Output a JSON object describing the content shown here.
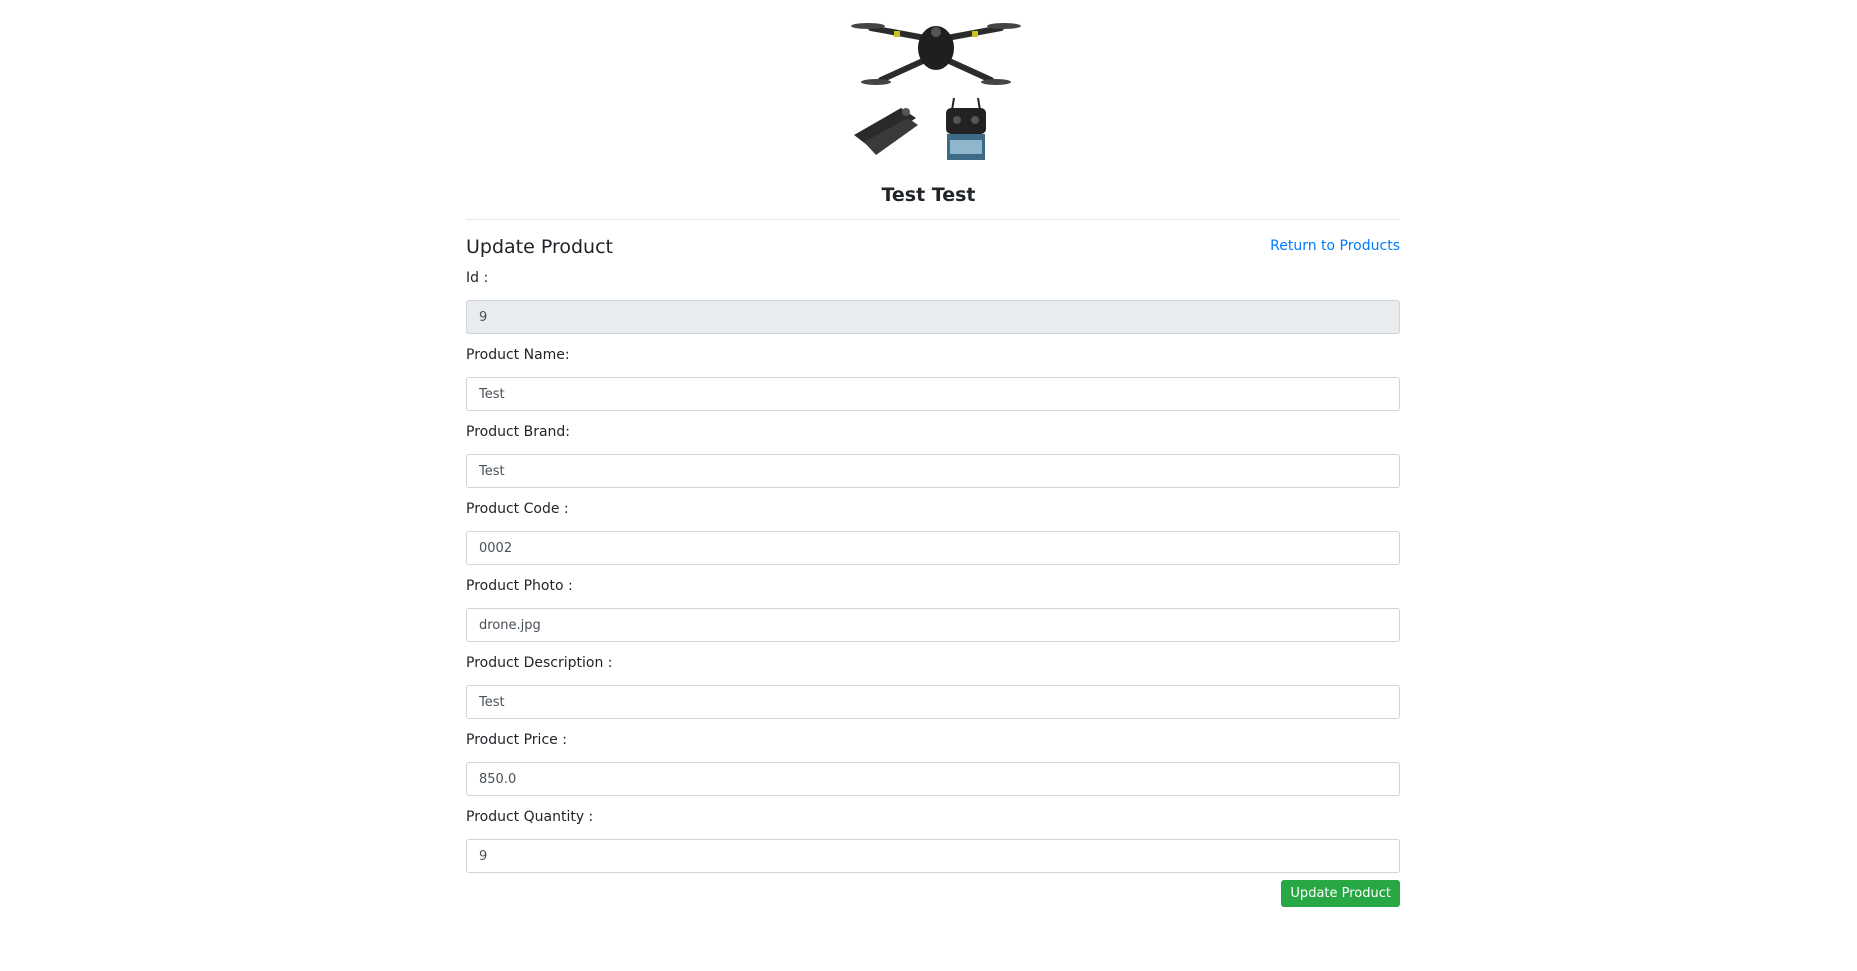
{
  "product": {
    "title": "Test Test",
    "image_icon": "drone-product-photo"
  },
  "form": {
    "heading": "Update Product",
    "return_link": "Return to Products",
    "fields": [
      {
        "label": "Id :",
        "value": "9",
        "readonly": true
      },
      {
        "label": "Product Name:",
        "value": "Test"
      },
      {
        "label": "Product Brand:",
        "value": "Test"
      },
      {
        "label": "Product Code :",
        "value": "0002"
      },
      {
        "label": "Product Photo :",
        "value": "drone.jpg"
      },
      {
        "label": "Product Description :",
        "value": "Test"
      },
      {
        "label": "Product Price :",
        "value": "850.0"
      },
      {
        "label": "Product Quantity :",
        "value": "9"
      }
    ],
    "submit_label": "Update Product"
  },
  "colors": {
    "link": "#007bff",
    "submit": "#28a745",
    "readonly_bg": "#e9ecef"
  }
}
